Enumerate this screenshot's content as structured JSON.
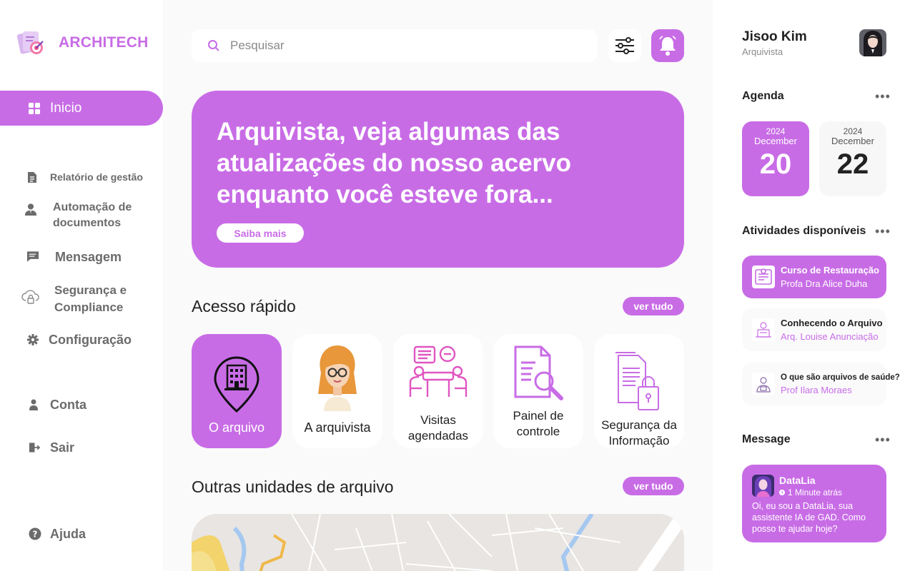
{
  "brand": {
    "name": "ARCHITECH"
  },
  "colors": {
    "accent": "#c86ce6",
    "sidebar_text": "#6b6b6b",
    "background": "#fafafa"
  },
  "sidebar": {
    "home_label": "Inicio",
    "items": [
      {
        "label": "Relatório de gestão",
        "icon": "document-icon"
      },
      {
        "label": "Automação de documentos",
        "icon": "user-tie-icon"
      },
      {
        "label": "Mensagem",
        "icon": "chat-icon"
      },
      {
        "label": "Segurança e Compliance",
        "icon": "cloud-lock-icon"
      },
      {
        "label": "Configuração",
        "icon": "gear-icon"
      },
      {
        "label": "Conta",
        "icon": "person-icon"
      },
      {
        "label": "Sair",
        "icon": "logout-icon"
      },
      {
        "label": "Ajuda",
        "icon": "help-icon"
      }
    ]
  },
  "search": {
    "placeholder": "Pesquisar"
  },
  "hero": {
    "title": "Arquivista, veja algumas das atualizações do nosso acervo enquanto você esteve fora...",
    "cta": "Saiba mais"
  },
  "quick_access": {
    "title": "Acesso rápido",
    "see_all": "ver tudo",
    "cards": [
      {
        "label": "O arquivo",
        "icon": "building-pin-icon"
      },
      {
        "label": "A arquivista",
        "icon": "woman-avatar-icon"
      },
      {
        "label": "Visitas agendadas",
        "icon": "meeting-icon"
      },
      {
        "label": "Painel de controle",
        "icon": "document-search-icon"
      },
      {
        "label": "Segurança da Informação",
        "icon": "document-lock-icon"
      }
    ]
  },
  "other_units": {
    "title": "Outras unidades de arquivo",
    "see_all": "ver tudo"
  },
  "user": {
    "name": "Jisoo Kim",
    "role": "Arquivista"
  },
  "agenda": {
    "title": "Agenda",
    "dates": [
      {
        "year": "2024",
        "month": "December",
        "day": "20",
        "selected": true
      },
      {
        "year": "2024",
        "month": "December",
        "day": "22",
        "selected": false
      }
    ]
  },
  "activities": {
    "title": "Atividades disponíveis",
    "items": [
      {
        "title": "Curso de Restauração",
        "subtitle": "Profa Dra Alice Duha"
      },
      {
        "title": "Conhecendo o Arquivo",
        "subtitle": "Arq. Louise Anunciação"
      },
      {
        "title": "O que são arquivos de saúde?",
        "subtitle": "Prof Ilara Moraes"
      }
    ]
  },
  "message": {
    "title": "Message",
    "sender": "DataLia",
    "time": "1 Minute atrás",
    "text": "Oi, eu sou a DataLia, sua assistente IA de GAD.  Como posso te ajudar hoje?"
  }
}
